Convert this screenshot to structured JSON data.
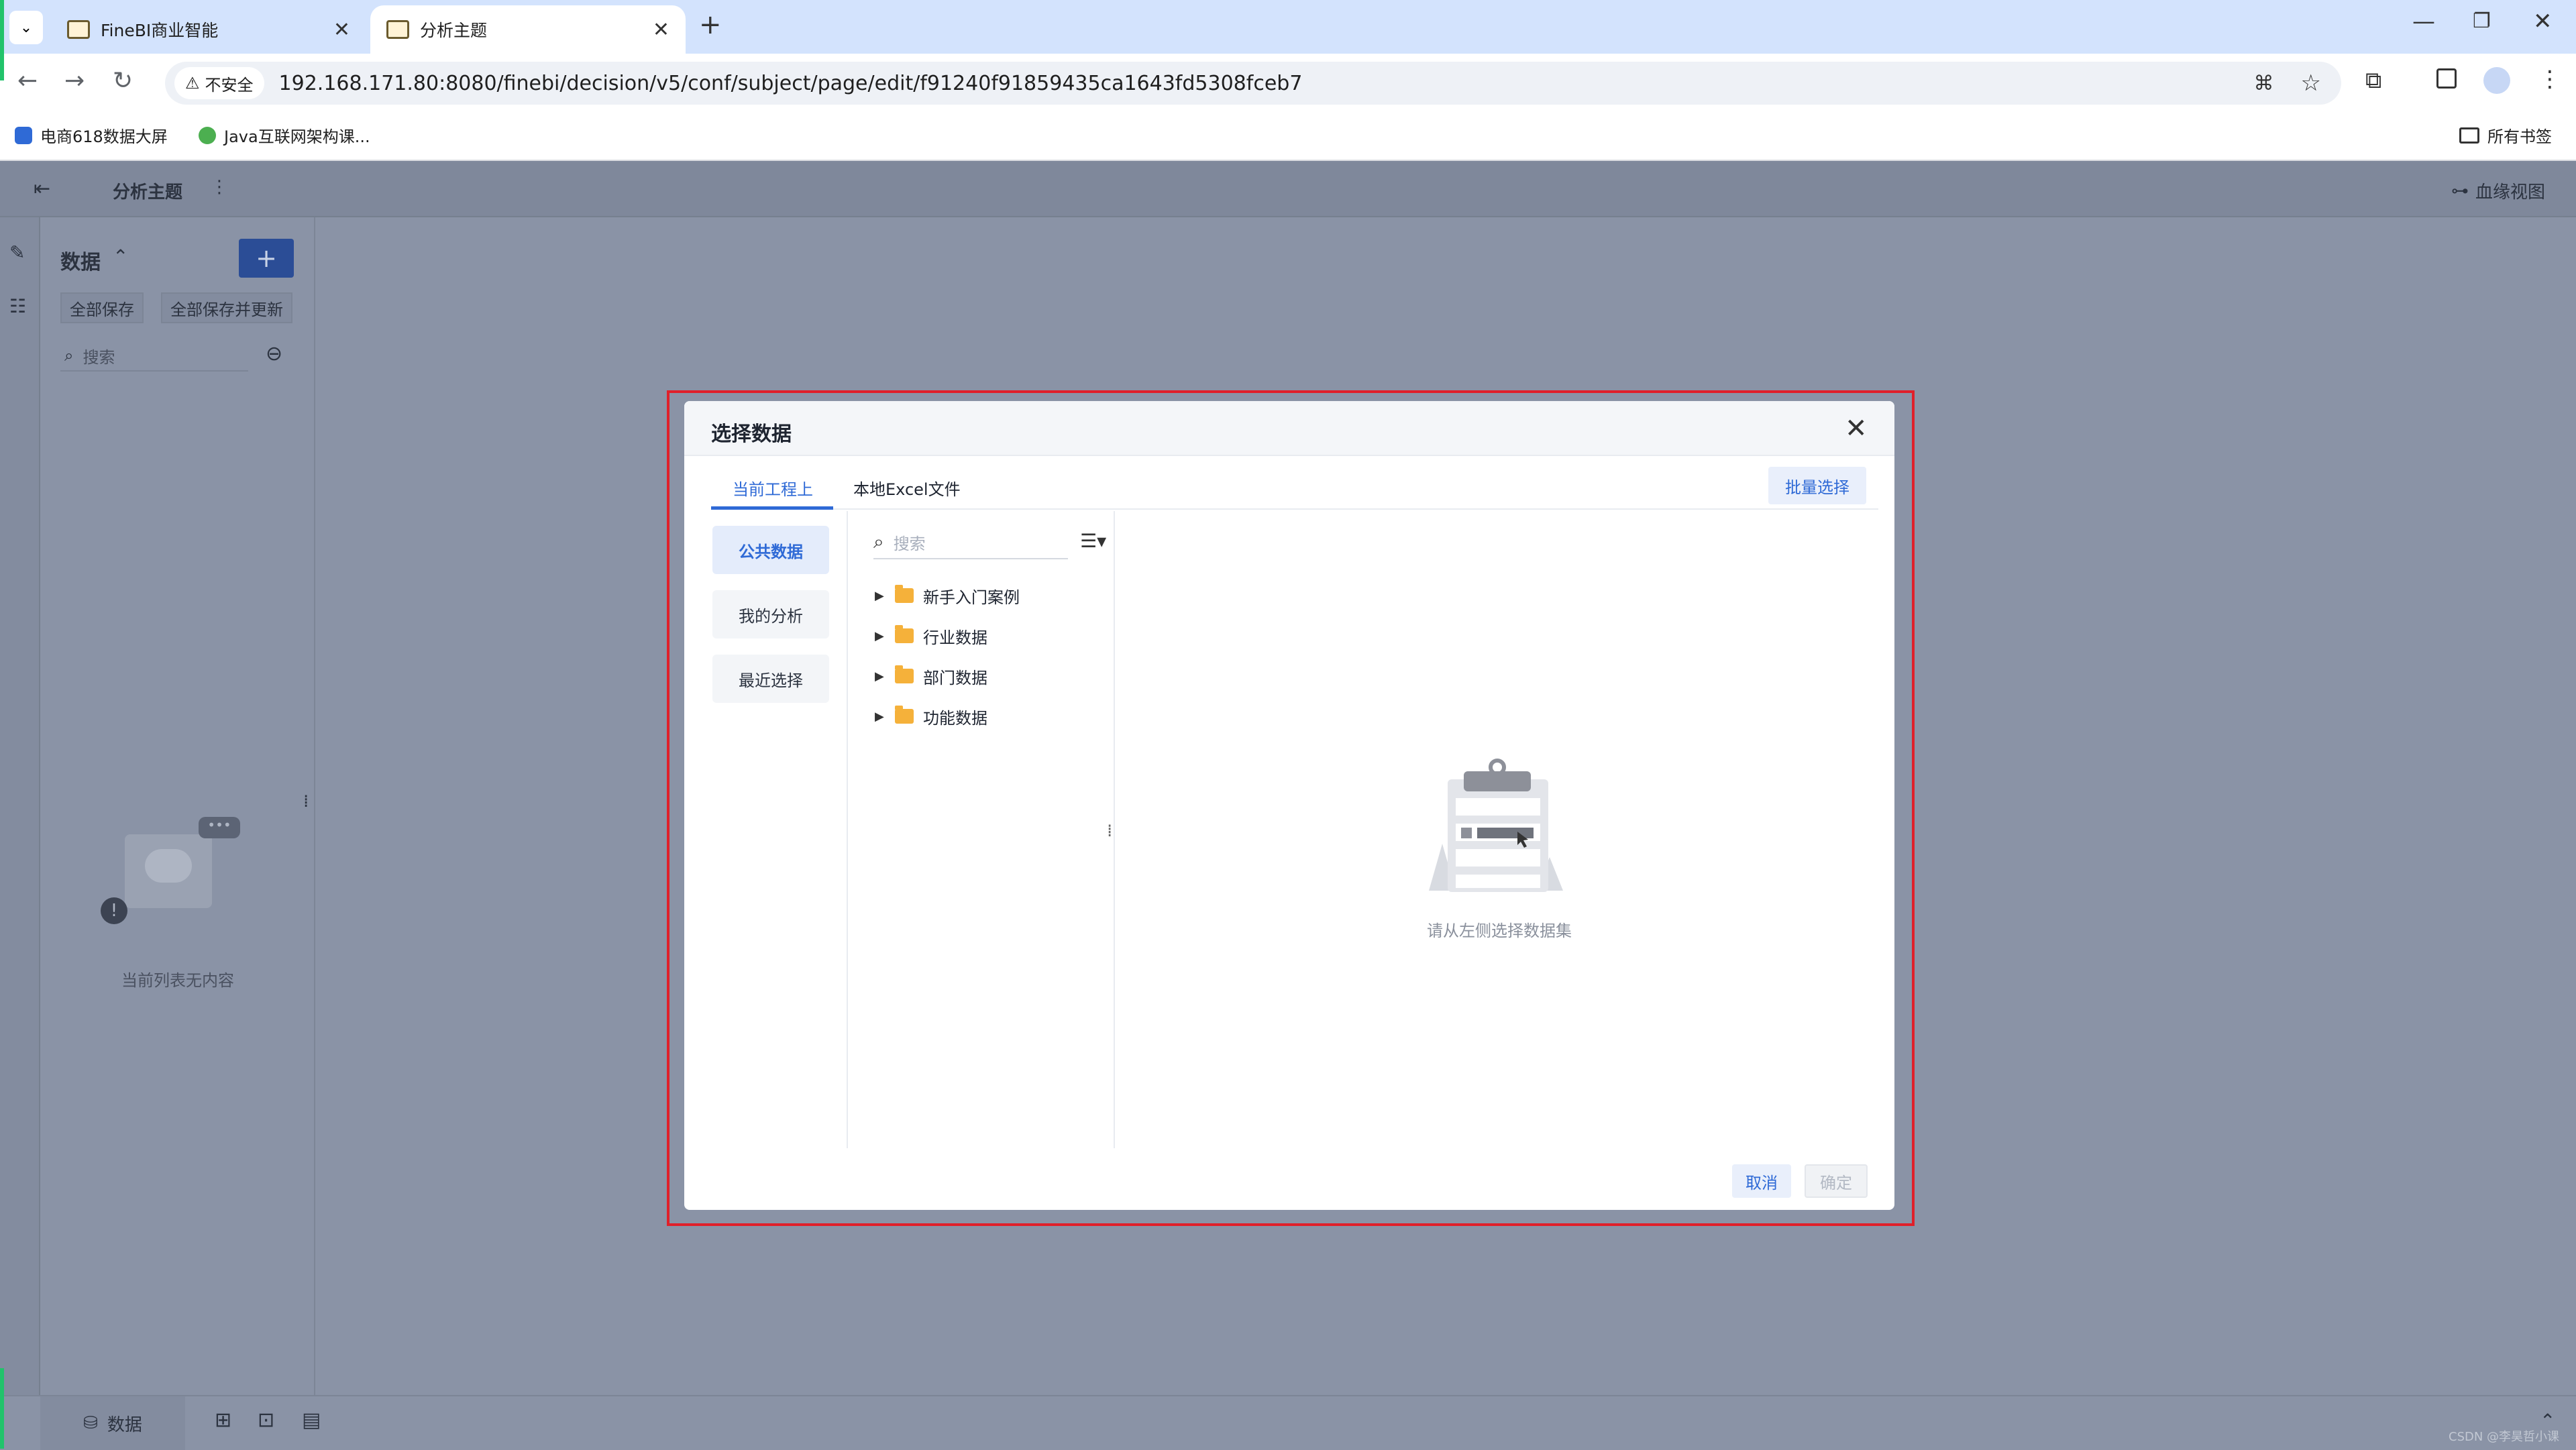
{
  "browser": {
    "tabs": [
      {
        "title": "FineBI商业智能"
      },
      {
        "title": "分析主题"
      }
    ],
    "security_label": "不安全",
    "url": "192.168.171.80:8080/finebi/decision/v5/conf/subject/page/edit/f91240f91859435ca1643fd5308fceb7",
    "bookmarks": [
      "电商618数据大屏",
      "Java互联网架构课..."
    ],
    "all_bookmarks": "所有书签"
  },
  "app": {
    "header_title": "分析主题",
    "lineage_view": "血缘视图",
    "data_panel": {
      "title": "数据",
      "save_all": "全部保存",
      "save_all_update": "全部保存并更新",
      "search_placeholder": "搜索",
      "empty_text": "当前列表无内容"
    },
    "bottom_tab": "数据",
    "watermark": "CSDN @李昊哲小课"
  },
  "dialog": {
    "title": "选择数据",
    "tabs": [
      "当前工程上",
      "本地Excel文件"
    ],
    "batch_select": "批量选择",
    "sidebar": [
      "公共数据",
      "我的分析",
      "最近选择"
    ],
    "search_placeholder": "搜索",
    "tree": [
      "新手入门案例",
      "行业数据",
      "部门数据",
      "功能数据"
    ],
    "empty_hint": "请从左侧选择数据集",
    "cancel": "取消",
    "confirm": "确定"
  },
  "colors": {
    "accent": "#2f6ad6",
    "overlay": "#8a93a6",
    "highlight_border": "#e0202a",
    "folder": "#f5b13a"
  }
}
